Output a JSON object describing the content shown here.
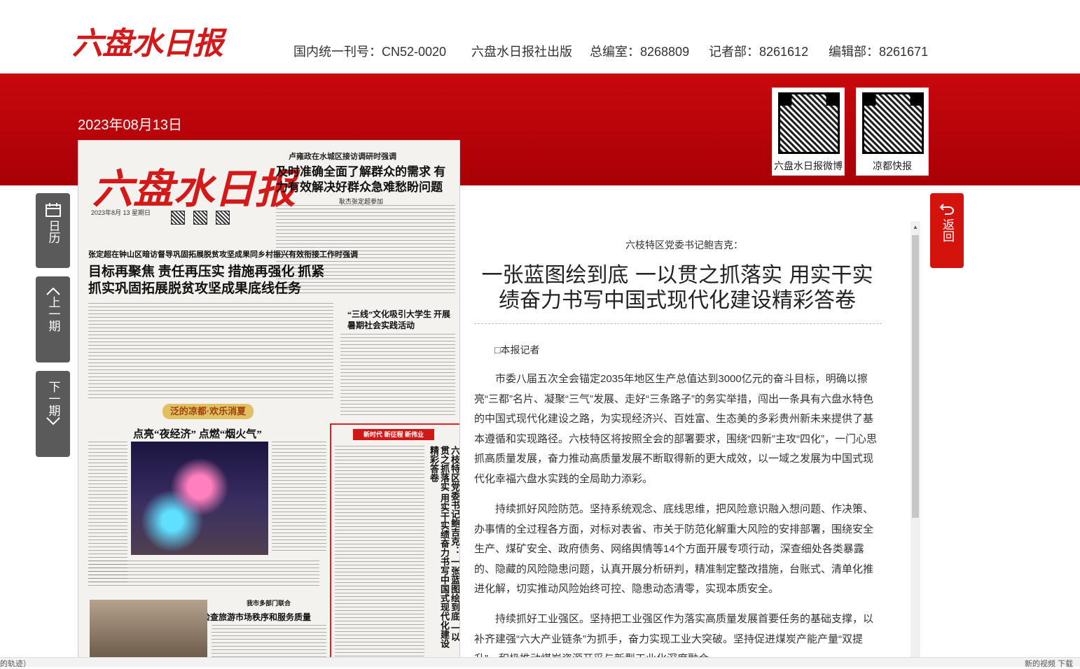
{
  "header": {
    "logo": "六盘水日报",
    "issn": "国内统一刊号：CN52-0020",
    "publisher": "六盘水日报社出版",
    "office_main": "总编室：8268809",
    "office_reporter": "记者部：8261612",
    "office_editor": "编辑部：8261671"
  },
  "date": "2023年08月13日",
  "qr": [
    {
      "caption": "六盘水日报微博"
    },
    {
      "caption": "凉都快报"
    }
  ],
  "side_nav": {
    "calendar": "日历",
    "prev": "上一期",
    "next": "下一期",
    "back": "返回"
  },
  "newspaper": {
    "logo": "六盘水日报",
    "top_sub": "卢雍政在水城区接访调研时强调",
    "top_head": "及时准确全面了解群众的需求 有力有效解决好群众急难愁盼问题",
    "top_byline": "耿杰张定超参加",
    "date_line": "2023年8月 13 星期日",
    "sub2": "张定超在钟山区暗访督导巩固拓展脱贫攻坚成果同乡村振兴有效衔接工作时强调",
    "h2": "目标再聚焦 责任再压实 措施再强化 抓紧抓实巩固拓展脱贫攻坚成果底线任务",
    "h3_culture": "“三线”文化吸引大学生 开展暑期社会实践活动",
    "ribbon": "泛的凉都·欢乐消夏",
    "h3_night": "点亮“夜经济” 点燃“烟火气”",
    "h3_tourism": "检查旅游市场秩序和服务质量",
    "tourism_sub": "我市多部门联合",
    "hl_banner": "新时代 新征程 新伟业",
    "vertical_title": "六枝特区党委书记鲍吉克： 一张蓝图绘到底 一以贯之抓落实 用实干实绩奋力书写中国式现代化建设精彩答卷"
  },
  "article": {
    "subtitle": "六枝特区党委书记鲍吉克：",
    "title": "一张蓝图绘到底 一以贯之抓落实 用实干实绩奋力书写中国式现代化建设精彩答卷",
    "reporter": "□本报记者",
    "paragraphs": [
      "市委八届五次全会锚定2035年地区生产总值达到3000亿元的奋斗目标，明确以擦亮“三都”名片、凝聚“三气”发展、走好“三条路子”的务实举措，闯出一条具有六盘水特色的中国式现代化建设之路，为实现经济兴、百姓富、生态美的多彩贵州新未来提供了基本遵循和实现路径。六枝特区将按照全会的部署要求，围绕“四新”主攻“四化”，一门心思抓高质量发展，奋力推动高质量发展不断取得新的更大成效，以一域之发展为中国式现代化幸福六盘水实践的全局助力添彩。",
      "持续抓好风险防范。坚持系统观念、底线思维，把风险意识融入想问题、作决策、办事情的全过程各方面，对标对表省、市关于防范化解重大风险的安排部署，围绕安全生产、煤矿安全、政府债务、网络舆情等14个方面开展专项行动，深查细处各类暴露的、隐藏的风险隐患问题，认真开展分析研判，精准制定整改措施，台账式、清单化推进化解，切实推动风险始终可控、隐患动态清零，实现本质安全。",
      "持续抓好工业强区。坚持把工业强区作为落实高质量发展首要任务的基础支撑，以补齐建强“六大产业链条”为抓手，奋力实现工业大突破。坚持促进煤炭产能产量“双提升”，积极推动煤炭资源开采与新型工业化深度融合。"
    ]
  },
  "bottom_bar": {
    "left": "的轨迹）",
    "right": "新的视频   下载"
  }
}
